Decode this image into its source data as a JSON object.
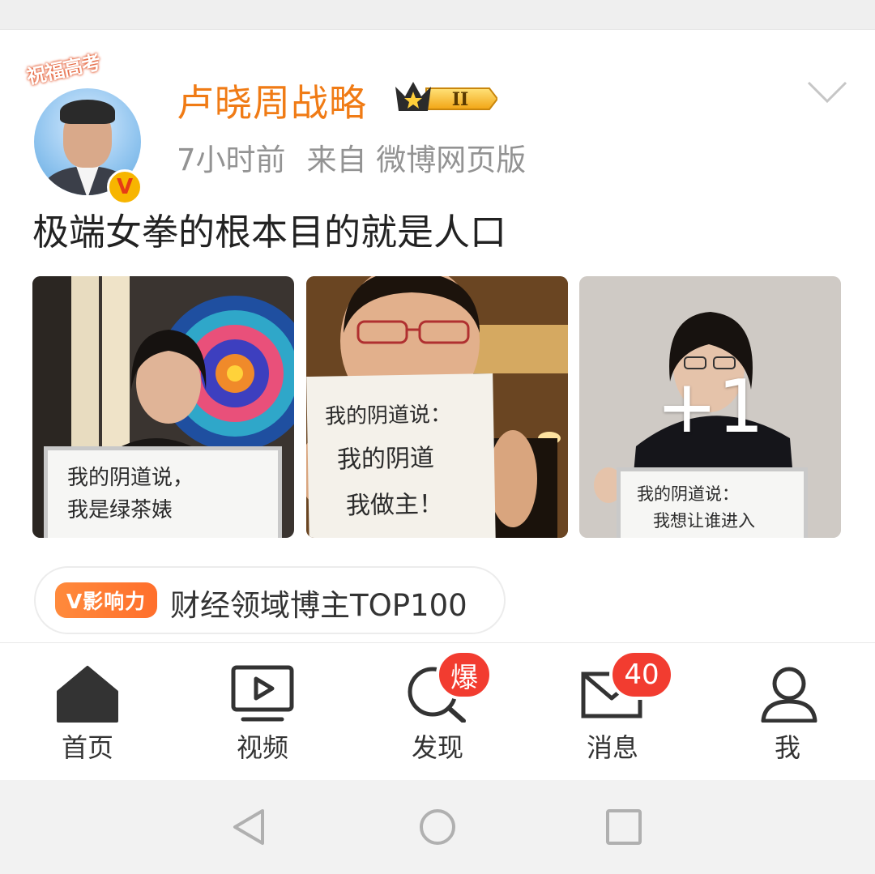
{
  "post": {
    "avatar_ribbon": "祝福高考",
    "verified_mark": "V",
    "username": "卢晓周战略",
    "level_badge": "II",
    "time": "7小时前",
    "source": "来自 微博网页版",
    "text": "极端女拳的根本目的就是人口",
    "photos": [
      {
        "board_lines": [
          "我的阴道说，",
          "我是绿茶婊"
        ]
      },
      {
        "board_lines": [
          "我的阴道说：",
          "我的阴道",
          "我做主！"
        ]
      },
      {
        "board_lines": [
          "我的阴道说：",
          "我想让谁进入"
        ],
        "more_label": "+1"
      }
    ],
    "influence": {
      "badge": "V影响力",
      "text": "财经领域博主TOP100"
    }
  },
  "tabbar": {
    "items": [
      {
        "label": "首页",
        "icon": "home-icon"
      },
      {
        "label": "视频",
        "icon": "video-icon"
      },
      {
        "label": "发现",
        "icon": "search-icon",
        "badge": "爆"
      },
      {
        "label": "消息",
        "icon": "mail-icon",
        "badge": "40"
      },
      {
        "label": "我",
        "icon": "profile-icon"
      }
    ]
  },
  "colors": {
    "username": "#f07b15",
    "badge": "#f23c30",
    "meta": "#939393"
  }
}
